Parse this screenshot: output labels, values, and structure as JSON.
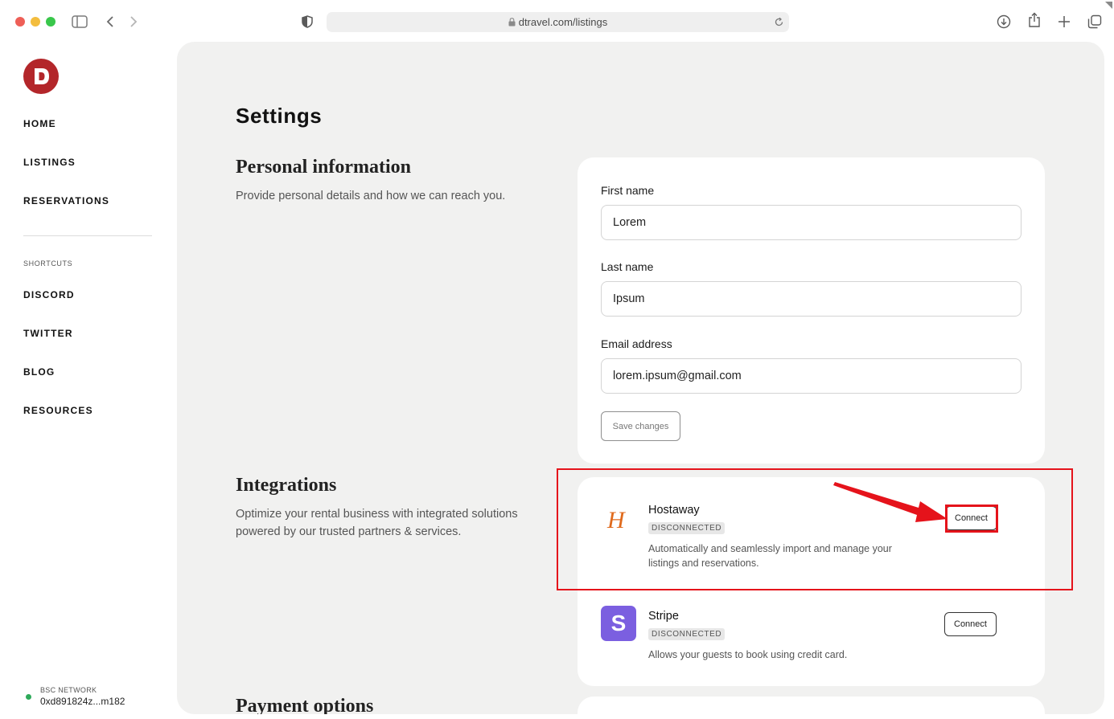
{
  "browser": {
    "url": "dtravel.com/listings",
    "traffic_lights": [
      "#ee5f57",
      "#f3bd3e",
      "#39c74b"
    ]
  },
  "sidebar": {
    "logo_letter": "D",
    "nav": [
      "HOME",
      "LISTINGS",
      "RESERVATIONS"
    ],
    "shortcuts_label": "SHORTCUTS",
    "shortcuts": [
      "DISCORD",
      "TWITTER",
      "BLOG",
      "RESOURCES"
    ],
    "network_label": "BSC NETWORK",
    "wallet_address": "0xd891824z...m182"
  },
  "main": {
    "title": "Settings",
    "personal": {
      "title": "Personal information",
      "description": "Provide personal details and how we can reach you.",
      "first_name_label": "First name",
      "first_name_value": "Lorem",
      "last_name_label": "Last name",
      "last_name_value": "Ipsum",
      "email_label": "Email address",
      "email_value": "lorem.ipsum@gmail.com",
      "save_label": "Save changes"
    },
    "integrations": {
      "title": "Integrations",
      "description": "Optimize your rental business with integrated solutions powered by our trusted partners & services.",
      "items": [
        {
          "name": "Hostaway",
          "logo_letter": "H",
          "status": "DISCONNECTED",
          "description": "Automatically and seamlessly import and manage your listings and reservations.",
          "action": "Connect"
        },
        {
          "name": "Stripe",
          "logo_letter": "S",
          "status": "DISCONNECTED",
          "description": "Allows your guests to book using credit card.",
          "action": "Connect"
        }
      ]
    },
    "payment": {
      "title": "Payment options"
    }
  },
  "colors": {
    "brand": "#b3262a",
    "stripe": "#7b5fe0",
    "hostaway": "#e06a1c",
    "annotation": "#e5131b"
  }
}
